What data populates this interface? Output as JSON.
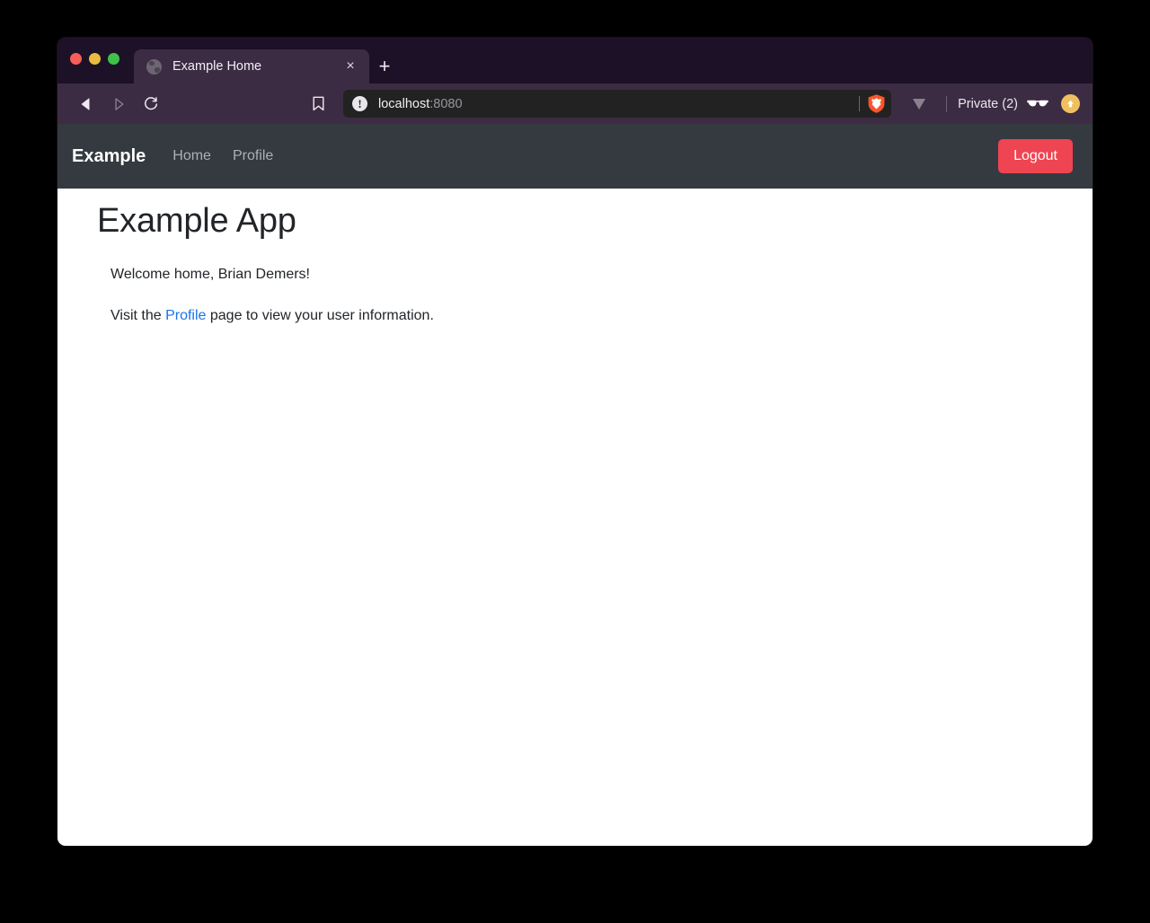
{
  "browser": {
    "name": "brave-browser",
    "window_controls": [
      "close",
      "minimize",
      "maximize"
    ],
    "tab": {
      "title": "Example Home",
      "favicon": "globe-icon",
      "close_label": "×"
    },
    "new_tab_label": "+",
    "nav": {
      "back_label": "Back",
      "forward_label": "Forward",
      "reload_label": "Reload",
      "bookmark_label": "Bookmark"
    },
    "urlbar": {
      "host": "localhost",
      "port": ":8080",
      "security_icon": "not-secure-info-icon",
      "shield_icon": "brave-shield-icon"
    },
    "right": {
      "downloads_icon": "downloads-chevron-icon",
      "private_label": "Private (2)",
      "private_icon": "sunglasses-icon",
      "profile_icon": "profile-avatar-icon"
    },
    "colors": {
      "tabstrip_bg": "#1d1128",
      "toolbar_bg": "#3c2c43",
      "urlbar_bg": "#222222",
      "brave_orange": "#fb542b"
    }
  },
  "page": {
    "navbar": {
      "brand": "Example",
      "links": [
        {
          "label": "Home"
        },
        {
          "label": "Profile"
        }
      ],
      "logout_label": "Logout",
      "bg_color": "#343a40",
      "logout_color": "#ef4452"
    },
    "heading": "Example App",
    "welcome_text": "Welcome home, Brian Demers!",
    "visit_prefix": "Visit the ",
    "visit_link": "Profile",
    "visit_suffix": " page to view your user information.",
    "link_color": "#1a73e8"
  }
}
